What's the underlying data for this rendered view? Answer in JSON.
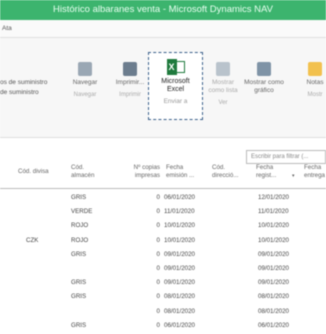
{
  "window": {
    "title": "Histórico albaranes venta - Microsoft Dynamics NAV"
  },
  "menubar": {
    "label": "Ata"
  },
  "ribbon": {
    "left_text": [
      "os de suministro",
      "de suministro"
    ],
    "buttons": [
      {
        "label": "Navegar",
        "group": "Navegar",
        "icon": "navigate-icon",
        "color": "#9aa7b4"
      },
      {
        "label": "Imprimir...",
        "group": "Imprimir",
        "icon": "print-icon",
        "color": "#6c7d8e"
      },
      {
        "label": "Mostrar como lista",
        "group": "Ver",
        "icon": "show-list-icon",
        "color": "#b9c3cc"
      },
      {
        "label": "Mostrar como gráfico",
        "group": "",
        "icon": "show-chart-icon",
        "color": "#7f93a6"
      },
      {
        "label": "Notas",
        "group": "Mostr",
        "icon": "notes-icon",
        "color": "#f2c14e"
      }
    ],
    "excel": {
      "label_line1": "Microsoft",
      "label_line2": "Excel",
      "group": "Enviar a",
      "color": "#1f7a3d"
    }
  },
  "filter": {
    "placeholder": "Escribir para filtrar (..."
  },
  "table": {
    "headers": [
      "Cód. divisa",
      "Cód. almacén",
      "Nº copias impresas",
      "Fecha emisión ...",
      "Cód. direcció...",
      "Fecha regist...",
      "Fecha entrega"
    ],
    "rows": [
      {
        "divisa": "",
        "almacen": "GRIS",
        "copias": "0",
        "emision": "06/01/2020",
        "direccion": "",
        "registro": "12/01/2020"
      },
      {
        "divisa": "",
        "almacen": "VERDE",
        "copias": "0",
        "emision": "11/01/2020",
        "direccion": "",
        "registro": "11/01/2020"
      },
      {
        "divisa": "",
        "almacen": "ROJO",
        "copias": "0",
        "emision": "10/01/2020",
        "direccion": "",
        "registro": "10/01/2020"
      },
      {
        "divisa": "CZK",
        "almacen": "ROJO",
        "copias": "0",
        "emision": "10/01/2020",
        "direccion": "",
        "registro": "10/01/2020"
      },
      {
        "divisa": "",
        "almacen": "GRIS",
        "copias": "0",
        "emision": "09/01/2020",
        "direccion": "",
        "registro": "09/01/2020"
      },
      {
        "divisa": "",
        "almacen": "",
        "copias": "0",
        "emision": "09/01/2020",
        "direccion": "",
        "registro": "09/01/2020"
      },
      {
        "divisa": "",
        "almacen": "GRIS",
        "copias": "0",
        "emision": "09/01/2020",
        "direccion": "",
        "registro": "09/01/2020"
      },
      {
        "divisa": "",
        "almacen": "GRIS",
        "copias": "0",
        "emision": "08/01/2020",
        "direccion": "",
        "registro": "08/01/2020"
      },
      {
        "divisa": "",
        "almacen": "",
        "copias": "0",
        "emision": "08/01/2020",
        "direccion": "",
        "registro": "08/01/2020"
      },
      {
        "divisa": "",
        "almacen": "GRIS",
        "copias": "0",
        "emision": "06/01/2020",
        "direccion": "",
        "registro": "06/01/2020"
      }
    ]
  }
}
